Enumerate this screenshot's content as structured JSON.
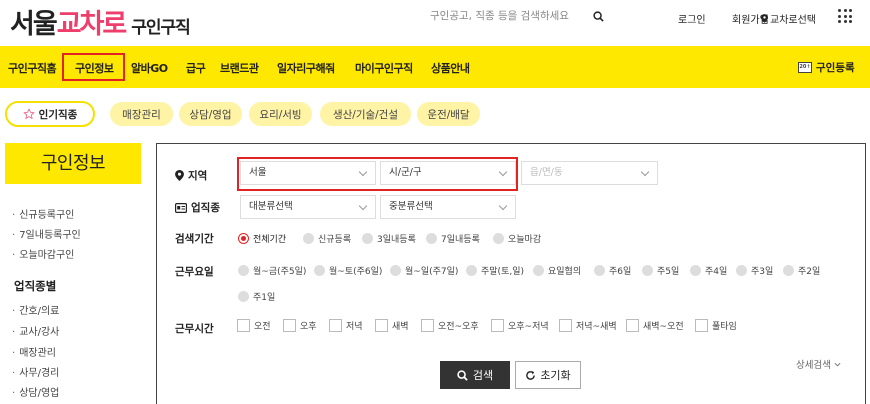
{
  "header": {
    "logo": {
      "part1": "서울",
      "part2": "교차로",
      "part3": "구인구직"
    },
    "search": {
      "placeholder": "구인공고, 직종 등을 검색하세요"
    },
    "links": {
      "login": "로그인",
      "signup": "회원가입",
      "region_select": "교차로선택"
    }
  },
  "nav": {
    "items": [
      "구인구직홈",
      "구인정보",
      "알바GO",
      "급구",
      "브랜드관",
      "일자리구해줘",
      "마이구인구직",
      "상품안내"
    ],
    "register": "구인등록",
    "register_icon_text": "20↑"
  },
  "chips": {
    "popular": "인기직종",
    "items": [
      "매장관리",
      "상담/영업",
      "요리/서빙",
      "생산/기술/건설",
      "운전/배달"
    ]
  },
  "sidebar": {
    "title": "구인정보",
    "links": [
      "신규등록구인",
      "7일내등록구인",
      "오늘마감구인"
    ],
    "section_title": "업직종별",
    "categories": [
      "간호/의료",
      "교사/강사",
      "매장관리",
      "사무/경리",
      "상담/영업"
    ]
  },
  "filters": {
    "region": {
      "label": "지역",
      "select1": "서울",
      "select2": "시/군/구",
      "select3": "읍/면/동"
    },
    "job": {
      "label": "업직종",
      "select1": "대분류선택",
      "select2": "중분류선택"
    },
    "period": {
      "label": "검색기간",
      "options": [
        "전체기간",
        "신규등록",
        "3일내등록",
        "7일내등록",
        "오늘마감"
      ],
      "selected": "전체기간"
    },
    "workdays": {
      "label": "근무요일",
      "options": [
        "월~금(주5일)",
        "월~토(주6일)",
        "월~일(주7일)",
        "주말(토,일)",
        "요일협의",
        "주6일",
        "주5일",
        "주4일",
        "주3일",
        "주2일",
        "주1일"
      ]
    },
    "worktime": {
      "label": "근무시간",
      "options": [
        "오전",
        "오후",
        "저녁",
        "새벽",
        "오전~오후",
        "오후~저녁",
        "저녁~새벽",
        "새벽~오전",
        "풀타임"
      ]
    },
    "more": "상세검색",
    "search_button": "검색",
    "reset_button": "초기화"
  },
  "colors": {
    "brand_yellow": "#ffe800",
    "brand_pink": "#ee3e6b",
    "highlight_red": "#e32323"
  }
}
